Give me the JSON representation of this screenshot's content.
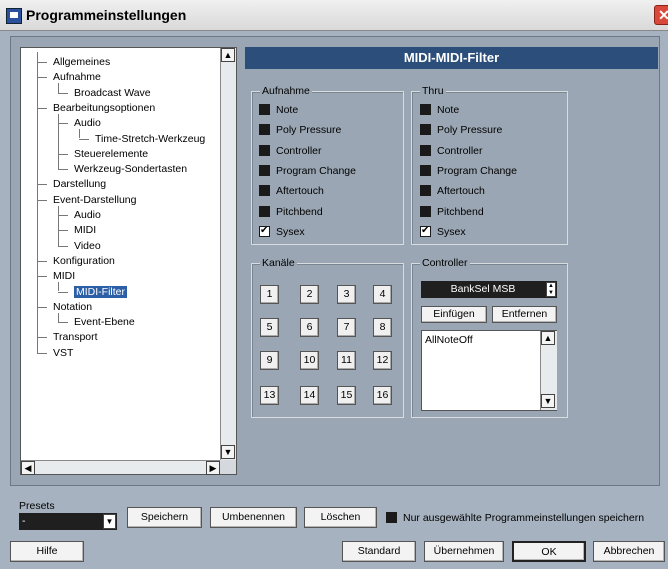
{
  "window": {
    "title": "Programmeinstellungen",
    "close_glyph": "✕"
  },
  "tree": {
    "items": [
      {
        "label": "Allgemeines",
        "level": 1
      },
      {
        "label": "Aufnahme",
        "level": 1
      },
      {
        "label": "Broadcast Wave",
        "level": 2
      },
      {
        "label": "Bearbeitungsoptionen",
        "level": 1
      },
      {
        "label": "Audio",
        "level": 2
      },
      {
        "label": "Time-Stretch-Werkzeug",
        "level": 3
      },
      {
        "label": "Steuerelemente",
        "level": 2
      },
      {
        "label": "Werkzeug-Sondertasten",
        "level": 2
      },
      {
        "label": "Darstellung",
        "level": 1
      },
      {
        "label": "Event-Darstellung",
        "level": 1
      },
      {
        "label": "Audio",
        "level": 2
      },
      {
        "label": "MIDI",
        "level": 2
      },
      {
        "label": "Video",
        "level": 2
      },
      {
        "label": "Konfiguration",
        "level": 1
      },
      {
        "label": "MIDI",
        "level": 1
      },
      {
        "label": "MIDI-Filter",
        "level": 2,
        "selected": true
      },
      {
        "label": "Notation",
        "level": 1
      },
      {
        "label": "Event-Ebene",
        "level": 2
      },
      {
        "label": "Transport",
        "level": 1
      },
      {
        "label": "VST",
        "level": 1
      }
    ]
  },
  "panel": {
    "header": "MIDI-MIDI-Filter",
    "aufnahme": {
      "title": "Aufnahme",
      "items": [
        {
          "label": "Note",
          "checked": false
        },
        {
          "label": "Poly Pressure",
          "checked": false
        },
        {
          "label": "Controller",
          "checked": false
        },
        {
          "label": "Program Change",
          "checked": false
        },
        {
          "label": "Aftertouch",
          "checked": false
        },
        {
          "label": "Pitchbend",
          "checked": false
        },
        {
          "label": "Sysex",
          "checked": true
        }
      ]
    },
    "thru": {
      "title": "Thru",
      "items": [
        {
          "label": "Note",
          "checked": false
        },
        {
          "label": "Poly Pressure",
          "checked": false
        },
        {
          "label": "Controller",
          "checked": false
        },
        {
          "label": "Program Change",
          "checked": false
        },
        {
          "label": "Aftertouch",
          "checked": false
        },
        {
          "label": "Pitchbend",
          "checked": false
        },
        {
          "label": "Sysex",
          "checked": true
        }
      ]
    },
    "kanaele": {
      "title": "Kanäle",
      "channels": [
        "1",
        "2",
        "3",
        "4",
        "5",
        "6",
        "7",
        "8",
        "9",
        "10",
        "11",
        "12",
        "13",
        "14",
        "15",
        "16"
      ]
    },
    "controller": {
      "title": "Controller",
      "selected": "BankSel MSB",
      "insert_label": "Einfügen",
      "remove_label": "Entfernen",
      "list": [
        "AllNoteOff"
      ]
    }
  },
  "presets": {
    "label": "Presets",
    "value": "-",
    "save_label": "Speichern",
    "rename_label": "Umbenennen",
    "delete_label": "Löschen",
    "only_selected_label": "Nur ausgewählte Programmeinstellungen speichern",
    "only_selected_checked": false
  },
  "footer": {
    "help_label": "Hilfe",
    "standard_label": "Standard",
    "apply_label": "Übernehmen",
    "ok_label": "OK",
    "cancel_label": "Abbrechen"
  }
}
